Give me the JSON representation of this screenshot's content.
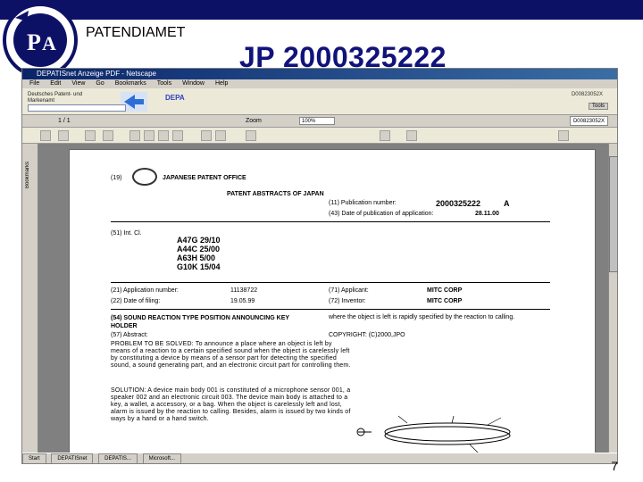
{
  "slide": {
    "brand": "PATENDIAMET",
    "title": "JP 2000325222",
    "page_number": "7"
  },
  "browser": {
    "document_id": "D00823052X",
    "tools_label": "Tools",
    "depa_label": "DEPA",
    "nav_page": "1 / 1",
    "zoom_value": "100%"
  },
  "abstract": {
    "number_label": "(19)",
    "office": "JAPANESE PATENT OFFICE",
    "heading": "PATENT ABSTRACTS OF JAPAN",
    "pub_number_label": "(11) Publication number:",
    "pub_number": "2000325222",
    "pub_kind": "A",
    "pub_date_label": "(43) Date of publication of application:",
    "pub_date": "28.11.00",
    "int_cl_label": "(51) Int. Cl.",
    "ipc": "A47G 29/10\nA44C 25/00\nA63H 5/00\nG10K 15/04",
    "app_number_label": "(21) Application number:",
    "app_number": "11138722",
    "applicant_label": "(71) Applicant:",
    "applicant": "MITC CORP",
    "filing_label": "(22) Date of filing:",
    "filing_date": "19.05.99",
    "inventor_label": "(72) Inventor:",
    "inventor": "MITC CORP",
    "title_line": "(54) SOUND REACTION TYPE POSITION ANNOUNCING KEY HOLDER",
    "abstract_label": "(57) Abstract:",
    "problem": "PROBLEM TO BE SOLVED: To announce a place where an object is left by means of a reaction to a certain specified sound when the object is carelessly left by constituting a device by means of a sensor part for detecting the specified sound, a sound generating part, and an electronic circuit part for controlling them.",
    "solution": "SOLUTION: A device main body 001 is constituted of a microphone sensor 001, a speaker 002 and an electronic circuit 003. The device main body is attached to a key, a wallet, a accessory, or a bag. When the object is carelessly left and lost, alarm is issued by the reaction to calling. Besides, alarm is issued by two kinds of ways by a hand or a hand switch.",
    "right_text": "where the object is left is rapidly specified by the reaction to calling.",
    "copyright": "COPYRIGHT: (C)2000,JPO"
  },
  "taskbar": {
    "start": "Start",
    "items": [
      "DEPATISnet",
      "DEPATIS...",
      "Microsoft..."
    ]
  }
}
